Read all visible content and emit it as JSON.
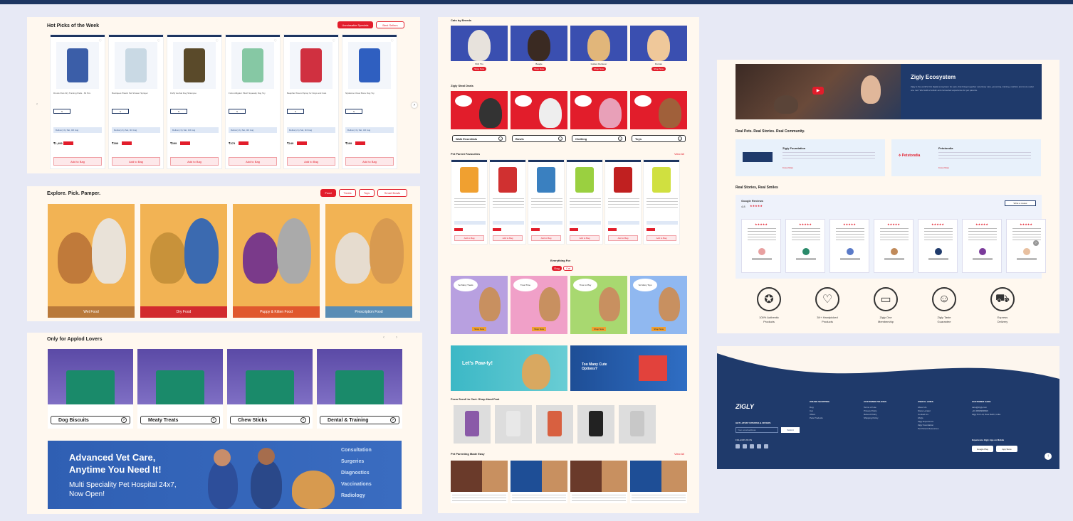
{
  "hot_picks": {
    "title": "Hot Picks of the Week",
    "tab_active": "Unmissable Specials",
    "tab_other": "Best Sellers",
    "products": [
      {
        "name": "Drools Pets Dry Training Pads - 60 Pcs",
        "chip": "S",
        "deliver": "Delivery by Sat, 3rd Aug",
        "price": "₹1,499",
        "cta": "Add to Bag"
      },
      {
        "name": "Bootiques Plastic Pet Shower Sprayer",
        "chip": "S",
        "deliver": "Delivery by Sat, 3rd Aug",
        "price": "₹399",
        "cta": "Add to Bag"
      },
      {
        "name": "Fluffy Herbal Dog Shampoo",
        "chip": "S",
        "deliver": "Delivery by Sat, 3rd Aug",
        "price": "₹399",
        "cta": "Add to Bag"
      },
      {
        "name": "Fofos Alligator Plush Squeaky Dog Toy",
        "chip": "S",
        "deliver": "Delivery by Sat, 3rd Aug",
        "price": "₹479",
        "cta": "Add to Bag"
      },
      {
        "name": "Beaphar Wound Spray for Dogs and Cats",
        "chip": "S",
        "deliver": "Delivery by Sat, 3rd Aug",
        "price": "₹249",
        "cta": "Add to Bag"
      },
      {
        "name": "Nylabone Chew Bone Dog Toy",
        "chip": "S",
        "deliver": "Delivery by Sat, 3rd Aug",
        "price": "₹399",
        "cta": "Add to Bag"
      }
    ]
  },
  "explore": {
    "title": "Explore. Pick. Pamper.",
    "tabs": [
      "Food",
      "Treats",
      "Toys",
      "Smart Bowls"
    ],
    "tiles": [
      {
        "label": "Wet Food",
        "color": "#b9793a"
      },
      {
        "label": "Dry Food",
        "color": "#d22a2e"
      },
      {
        "label": "Puppy & Kitten Food",
        "color": "#e0582e"
      },
      {
        "label": "Prescription Food",
        "color": "#5a8db5"
      }
    ]
  },
  "applod": {
    "title": "Only for Applod Lovers",
    "categories": [
      "Dog Biscuits",
      "Meaty Treats",
      "Chew Sticks",
      "Dental & Training"
    ]
  },
  "vet_banner": {
    "heading1": "Advanced Vet Care,",
    "heading2": "Anytime You Need It!",
    "sub1": "Multi Speciality Pet Hospital 24x7,",
    "sub2": "Now Open!",
    "services": [
      "Consultation",
      "Surgeries",
      "Diagnostics",
      "Vaccinations",
      "Radiology"
    ]
  },
  "shop_breed": {
    "title": "Cats by Breeds",
    "breeds": [
      "Shih Tzu",
      "Beagle",
      "Golden Retriever",
      "Persian"
    ],
    "cta": "Shop Now"
  },
  "zigly_deals": {
    "title": "Zigly Steal Deals",
    "items": [
      "Walk Essentials",
      "Bowls",
      "Clothing",
      "Toys"
    ]
  },
  "pet_parent": {
    "title": "Pet Parent Favourites",
    "view_all": "View All",
    "cta": "Add to Bag"
  },
  "everything_for": {
    "title": "Everything For",
    "toggle": [
      "Dog",
      "Cat"
    ],
    "bubbles": [
      "So Many Treats",
      "Treat Time",
      "Time to Play",
      "So Many Toys"
    ],
    "cta": "Shop Now"
  },
  "banners": {
    "left": "Let's Paw-ty!",
    "right": "Too Many Cute Options?"
  },
  "scroll_to_cart": {
    "title": "From Scroll to Cart: Shop Hard Fast"
  },
  "pet_parenting": {
    "title": "Pet Parenting Made Easy",
    "view_all": "View All"
  },
  "ecosystem": {
    "title": "Zigly Ecosystem",
    "body": "Zigly is the world's first digital ecosystem for pets, that brings together veterinary care, grooming, training, nutrition and more under one roof. We build a holistic and connected experience for pet parents."
  },
  "real_pets": {
    "title": "Real Pets. Real Stories. Real Community.",
    "cards": [
      {
        "name": "Zigly Foundation",
        "link": "Know More"
      },
      {
        "name": "Petstondia",
        "link": "Know More"
      }
    ]
  },
  "reviews": {
    "title": "Real Stories, Real Smiles",
    "source": "Google Reviews",
    "rating": "4.8",
    "write_btn": "Write a review",
    "count": 7
  },
  "usp": [
    {
      "icon": "authentic-badge-icon",
      "label1": "100% Authentic",
      "label2": "Products"
    },
    {
      "icon": "handpicked-bag-icon",
      "label1": "3K+ Handpicked",
      "label2": "Products"
    },
    {
      "icon": "membership-card-icon",
      "label1": "Zigly One",
      "label2": "Membership"
    },
    {
      "icon": "taste-guarantee-icon",
      "label1": "Zigly Taste",
      "label2": "Guarantee"
    },
    {
      "icon": "express-delivery-icon",
      "label1": "Express",
      "label2": "Delivery"
    }
  ],
  "footer": {
    "logo": "ZIGLY",
    "newsletter_label": "GET LATEST UPDATES & OFFERS",
    "email_placeholder": "Your email address",
    "submit": "Submit",
    "follow": "FOLLOW US ON",
    "cols": [
      {
        "h": "ONLINE SHOPPING",
        "items": [
          "Dog",
          "Cat",
          "Offers",
          "Pets Products"
        ]
      },
      {
        "h": "CUSTOMER POLICIES",
        "items": [
          "Terms of Use",
          "Privacy Policy",
          "Refund Policy",
          "Shipping Policy"
        ]
      },
      {
        "h": "USEFUL LINKS",
        "items": [
          "About Us",
          "Store Locator",
          "Contact Us",
          "FAQs",
          "Zigly Experience",
          "Zigly Foundation",
          "Pet Parent Resources"
        ]
      },
      {
        "h": "CUSTOMER CARE",
        "items": [
          "care@zigly.com",
          "+91 9999999999",
          "Zigly Pvt Ltd, New Delhi, India"
        ]
      }
    ],
    "app_label": "Experience Zigly App on Mobile",
    "app_btns": [
      "Google Play",
      "App Store"
    ]
  }
}
